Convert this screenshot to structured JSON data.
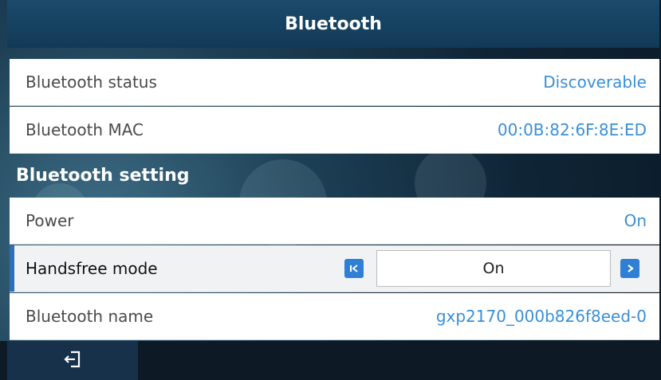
{
  "header": {
    "title": "Bluetooth"
  },
  "status_rows": [
    {
      "label": "Bluetooth status",
      "value": "Discoverable"
    },
    {
      "label": "Bluetooth MAC",
      "value": "00:0B:82:6F:8E:ED"
    }
  ],
  "settings": {
    "section_title": "Bluetooth setting",
    "power": {
      "label": "Power",
      "value": "On"
    },
    "handsfree": {
      "label": "Handsfree mode",
      "value": "On"
    },
    "name": {
      "label": "Bluetooth name",
      "value": "gxp2170_000b826f8eed-0"
    }
  },
  "icons": {
    "prev": "skip-previous-icon",
    "next": "chevron-right-icon",
    "exit": "exit-icon"
  },
  "colors": {
    "accent": "#2f6fb8",
    "value_text": "#3a8fd6",
    "header_bg": "#164260"
  }
}
